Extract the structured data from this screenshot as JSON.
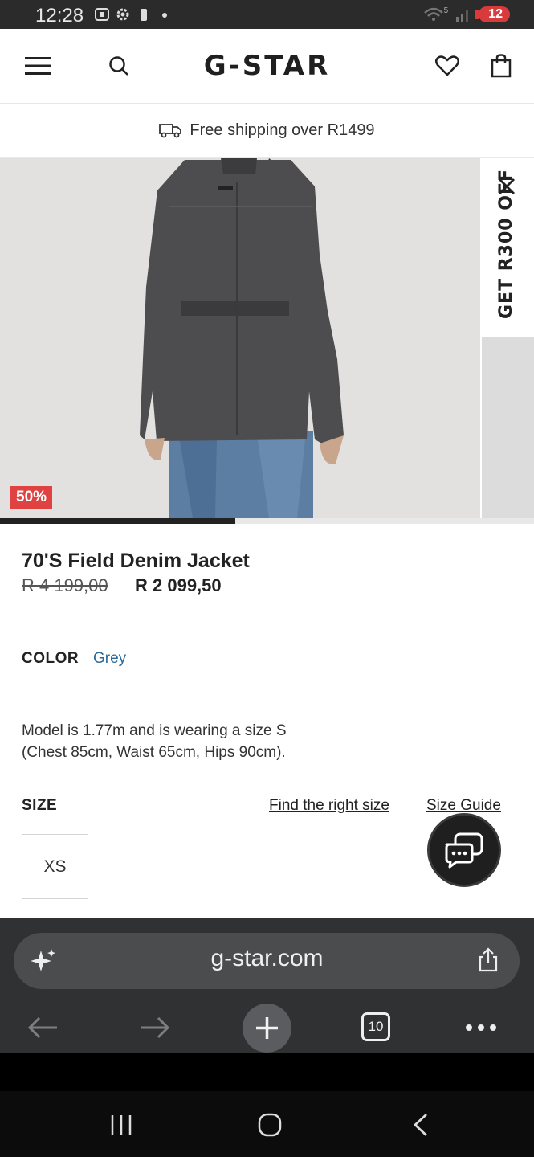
{
  "status_bar": {
    "time": "12:28",
    "signal_label": "5",
    "battery": "12"
  },
  "header": {
    "menu_icon": "hamburger-icon",
    "search_icon": "search-icon",
    "logo": "G-STAR",
    "wishlist_icon": "heart-icon",
    "bag_icon": "shopping-bag-icon"
  },
  "shipping": {
    "text": "Free shipping over R1499",
    "icon": "truck-icon"
  },
  "promo": {
    "text": "GET R300 OFF",
    "close_icon": "close-icon"
  },
  "product": {
    "discount_badge": "50%",
    "image_progress": 0.44,
    "title": "70'S Field Denim Jacket",
    "price_old": "R 4 199,00",
    "price_new": "R 2 099,50",
    "color_label": "COLOR",
    "color_value": "Grey",
    "model_info_line1": "Model is 1.77m and is wearing a size S",
    "model_info_line2": "(Chest 85cm, Waist 65cm, Hips 90cm).",
    "size_label": "SIZE",
    "find_size_link": "Find the right size",
    "size_guide_link": "Size Guide",
    "sizes": [
      "XS"
    ]
  },
  "browser": {
    "url": "g-star.com",
    "tab_count": "10",
    "colors": {
      "toolbar": "#2f3133",
      "urlbar": "#4a4c4e"
    }
  },
  "colors": {
    "accent_red": "#e04141",
    "link_blue": "#2c6a9a"
  }
}
